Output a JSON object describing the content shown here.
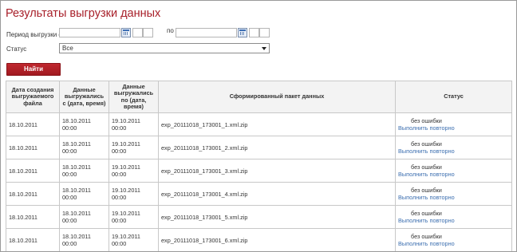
{
  "page": {
    "title": "Результаты выгрузки данных"
  },
  "filters": {
    "period_label": "Период выгрузки с",
    "to_label": "по",
    "date_from_value": "",
    "date_to_value": "",
    "status_label": "Статус",
    "status_selected": "Все"
  },
  "actions": {
    "find_label": "Найти"
  },
  "table": {
    "headers": {
      "created": "Дата создания выгружаемого файла",
      "from": "Данные выгружались с (дата, время)",
      "to": "Данные выгружались по (дата, время)",
      "package": "Сформированный пакет данных",
      "status": "Статус"
    },
    "rows": [
      {
        "created": "18.10.2011",
        "from": "18.10.2011 00:00",
        "to": "19.10.2011 00:00",
        "package": "exp_20111018_173001_1.xml.zip",
        "status": "без ошибки",
        "action": "Выполнить повторно"
      },
      {
        "created": "18.10.2011",
        "from": "18.10.2011 00:00",
        "to": "19.10.2011 00:00",
        "package": "exp_20111018_173001_2.xml.zip",
        "status": "без ошибки",
        "action": "Выполнить повторно"
      },
      {
        "created": "18.10.2011",
        "from": "18.10.2011 00:00",
        "to": "19.10.2011 00:00",
        "package": "exp_20111018_173001_3.xml.zip",
        "status": "без ошибки",
        "action": "Выполнить повторно"
      },
      {
        "created": "18.10.2011",
        "from": "18.10.2011 00:00",
        "to": "19.10.2011 00:00",
        "package": "exp_20111018_173001_4.xml.zip",
        "status": "без ошибки",
        "action": "Выполнить повторно"
      },
      {
        "created": "18.10.2011",
        "from": "18.10.2011 00:00",
        "to": "19.10.2011 00:00",
        "package": "exp_20111018_173001_5.xml.zip",
        "status": "без ошибки",
        "action": "Выполнить повторно"
      },
      {
        "created": "18.10.2011",
        "from": "18.10.2011 00:00",
        "to": "19.10.2011 00:00",
        "package": "exp_20111018_173001_6.xml.zip",
        "status": "без ошибки",
        "action": "Выполнить повторно"
      }
    ]
  }
}
